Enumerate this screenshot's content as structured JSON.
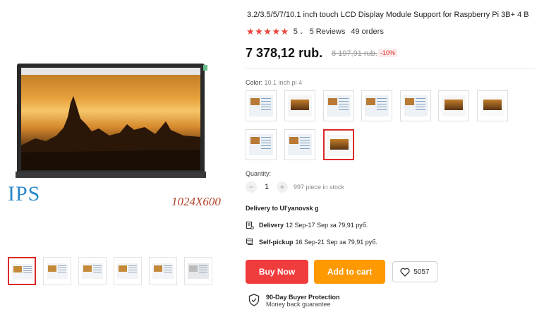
{
  "gallery": {
    "caption_panel": "IPS",
    "caption_resolution": "1024X600",
    "thumbnail_count": 6
  },
  "product": {
    "title": "3.2/3.5/5/7/10.1 inch touch LCD Display Module Support for Raspberry Pi 3B+ 4 B",
    "rating": "5",
    "reviews": "5 Reviews",
    "orders": "49 orders",
    "price": "7 378,12 rub.",
    "old_price": "8 197,91 rub.",
    "discount": "-10%"
  },
  "color": {
    "label": "Color:",
    "value": "10.1 inch pi 4",
    "selected_index": 9
  },
  "quantity": {
    "label": "Quantity:",
    "minus": "−",
    "value": "1",
    "plus": "+",
    "stock": "997 piece in stock"
  },
  "delivery": {
    "to": "Delivery to Ul'yanovsk g",
    "delivery_label": "Delivery",
    "delivery_text": "12 Sep-17 Sep за 79,91 руб.",
    "pickup_label": "Self-pickup",
    "pickup_text": "16 Sep-21 Sep за 79,91 руб."
  },
  "actions": {
    "buy_now": "Buy Now",
    "add_to_cart": "Add to cart",
    "wishlist_count": "5057"
  },
  "protection": {
    "title": "90-Day Buyer Protection",
    "subtitle": "Money back guarantee"
  },
  "colors": {
    "accent_red": "#f03c3c",
    "accent_orange": "#ff9900",
    "star": "#e8453c"
  }
}
